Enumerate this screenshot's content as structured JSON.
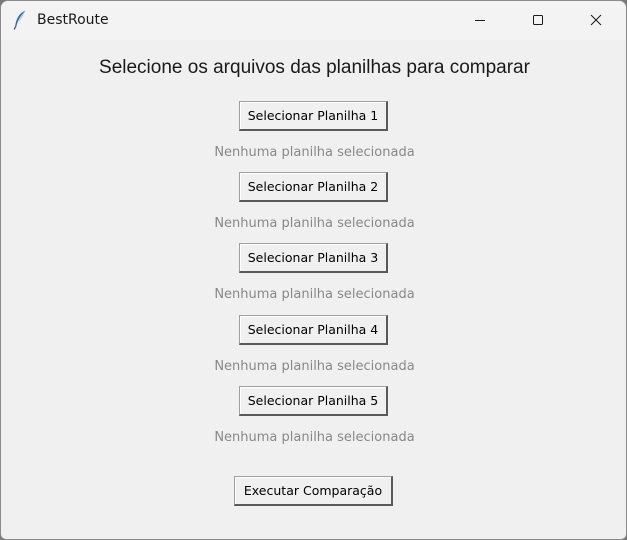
{
  "window": {
    "title": "BestRoute",
    "icons": {
      "app": "feather-icon",
      "minimize": "minimize-icon",
      "maximize": "maximize-icon",
      "close": "close-icon"
    }
  },
  "main": {
    "heading": "Selecione os arquivos das planilhas para comparar",
    "selectors": [
      {
        "button_label": "Selecionar Planilha 1",
        "status": "Nenhuma planilha selecionada"
      },
      {
        "button_label": "Selecionar Planilha 2",
        "status": "Nenhuma planilha selecionada"
      },
      {
        "button_label": "Selecionar Planilha 3",
        "status": "Nenhuma planilha selecionada"
      },
      {
        "button_label": "Selecionar Planilha 4",
        "status": "Nenhuma planilha selecionada"
      },
      {
        "button_label": "Selecionar Planilha 5",
        "status": "Nenhuma planilha selecionada"
      }
    ],
    "execute_label": "Executar Comparação"
  },
  "colors": {
    "status_text": "#888888",
    "window_bg": "#f0f0f0"
  }
}
